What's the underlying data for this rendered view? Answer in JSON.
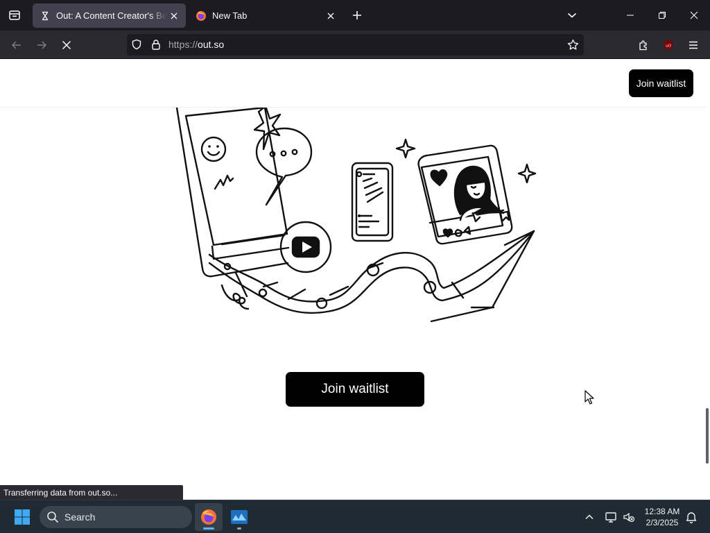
{
  "browser": {
    "tabs": [
      {
        "title": "Out: A Content Creator's Best Fr",
        "icon": "hourglass-icon",
        "active": true
      },
      {
        "title": "New Tab",
        "icon": "firefox-icon",
        "active": false
      }
    ],
    "url": {
      "protocol": "https://",
      "host": "out.so"
    },
    "status_text": "Transferring data from out.so..."
  },
  "page": {
    "header_button": "Join waitlist",
    "cta_button": "Join waitlist"
  },
  "taskbar": {
    "search_label": "Search",
    "time": "12:38 AM",
    "date": "2/3/2025"
  }
}
